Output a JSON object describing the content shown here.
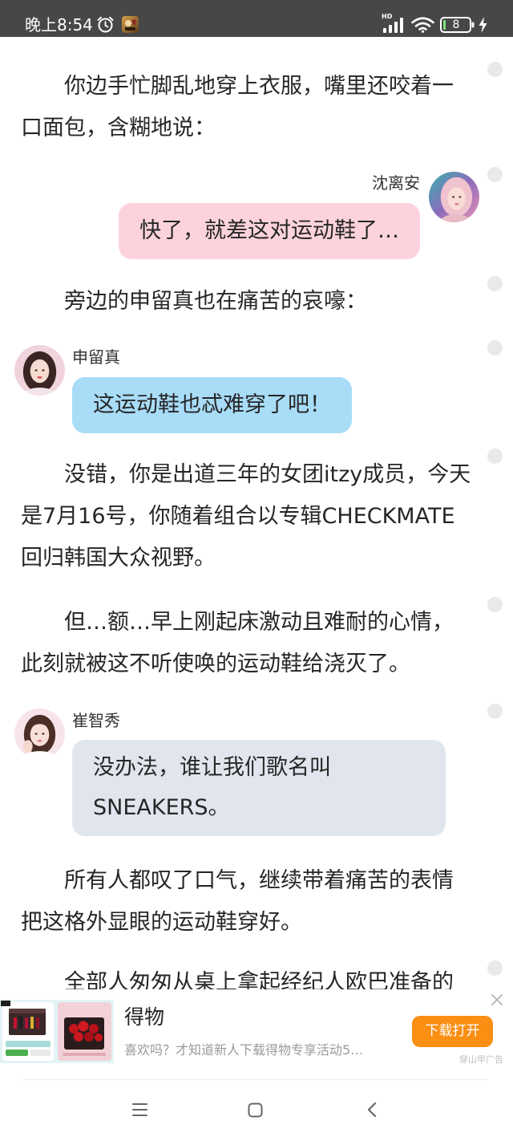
{
  "status_bar": {
    "time": "晚上8:54",
    "network_label": "HD",
    "battery_level": "8",
    "background_color": "#474747",
    "icons": [
      "alarm-clock-icon",
      "app-notification-icon",
      "signal-bars-icon",
      "wifi-icon",
      "battery-icon",
      "charging-bolt-icon"
    ]
  },
  "story": {
    "paragraphs": [
      "你边手忙脚乱地穿上衣服，嘴里还咬着一口面包，含糊地说：",
      "旁边的申留真也在痛苦的哀嚎：",
      "没错，你是出道三年的女团itzy成员，今天是7月16号，你随着组合以专辑CHECKMATE回归韩国大众视野。",
      "但…额…早上刚起床激动且难耐的心情，此刻就被这不听使唤的运动鞋给浇灭了。",
      "所有人都叹了口气，继续带着痛苦的表情把这格外显眼的运动鞋穿好。",
      "全部人匆匆从桌上拿起经纪人欧巴准备的"
    ],
    "messages": [
      {
        "speaker": "沈离安",
        "side": "right",
        "text": "快了，就差这对运动鞋了…",
        "bubble_color": "#fcd3dc"
      },
      {
        "speaker": "申留真",
        "side": "left",
        "text": "这运动鞋也忒难穿了吧！",
        "bubble_color": "#a8dcf7"
      },
      {
        "speaker": "崔智秀",
        "side": "left",
        "text": "没办法，谁让我们歌名叫SNEAKERS。",
        "bubble_color": "#e1e6ee"
      }
    ],
    "comment_marker_icon": "comment-dot-icon"
  },
  "ad": {
    "title": "得物",
    "description": "喜欢吗？才知道新人下载得物专享活动5…",
    "button_label": "下载打开",
    "button_color": "#fa8f14",
    "source_label": "穿山甲广告",
    "close_icon": "close-icon"
  },
  "nav_bar": {
    "icons": [
      "menu-icon",
      "home-square-icon",
      "back-chevron-icon"
    ]
  }
}
